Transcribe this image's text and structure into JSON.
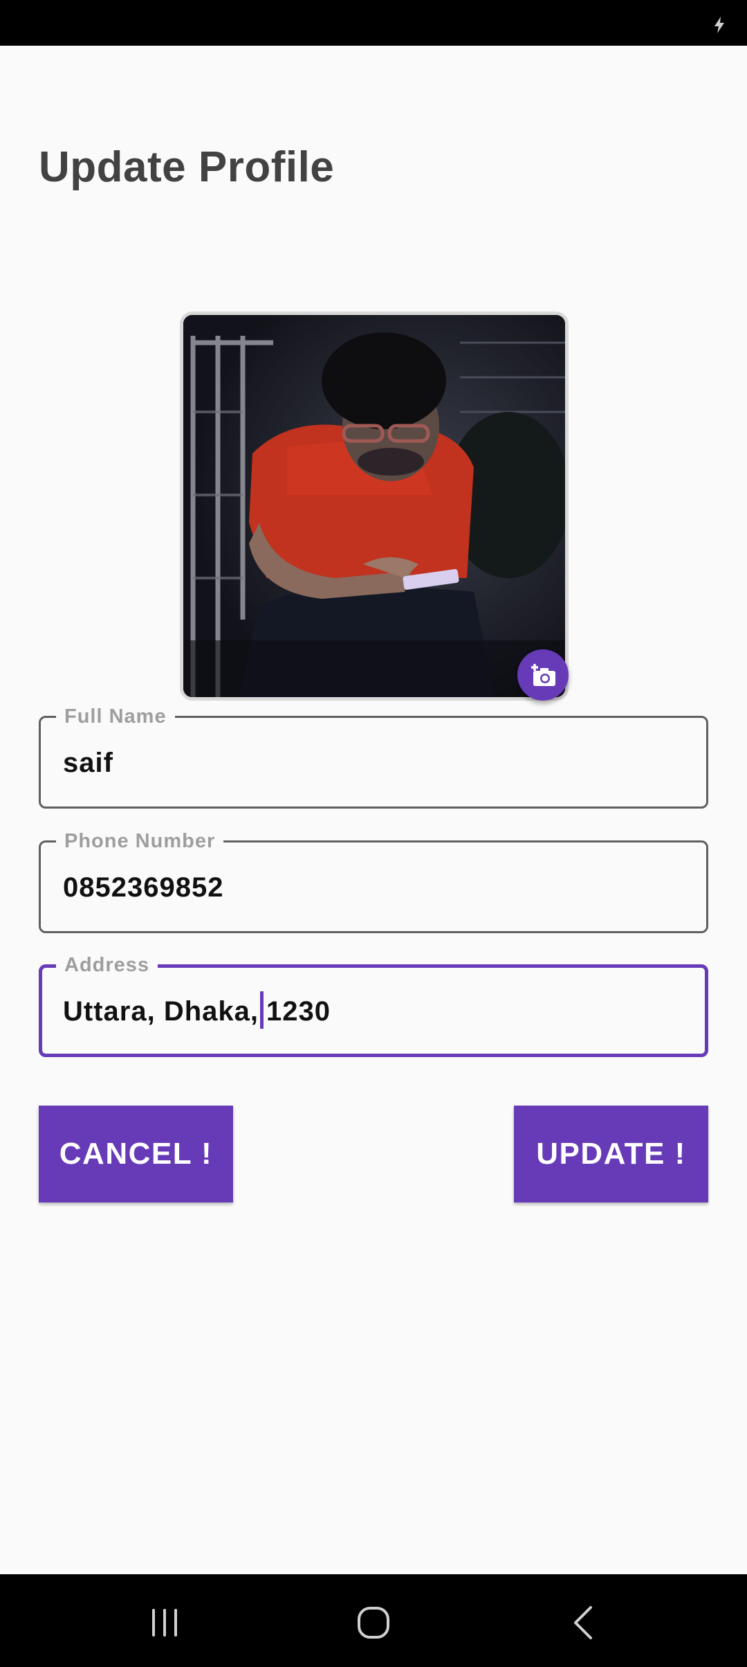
{
  "status_bar": {
    "charging_icon": "lightning-bolt-icon"
  },
  "page": {
    "title": "Update Profile"
  },
  "profile_photo": {
    "alt_icon": "profile-photo",
    "edit_icon": "add-photo-camera-icon",
    "accent_color": "#673ab7"
  },
  "form": {
    "full_name": {
      "label": "Full Name",
      "value": "saif"
    },
    "phone": {
      "label": "Phone Number",
      "value": "0852369852"
    },
    "address": {
      "label": "Address",
      "value_before_caret": "Uttara, Dhaka,",
      "value_after_caret": "1230"
    }
  },
  "buttons": {
    "cancel_label": "CANCEL !",
    "update_label": "UPDATE !"
  },
  "nav_bar": {
    "recents_icon": "recents-icon",
    "home_icon": "home-icon",
    "back_icon": "back-icon"
  }
}
